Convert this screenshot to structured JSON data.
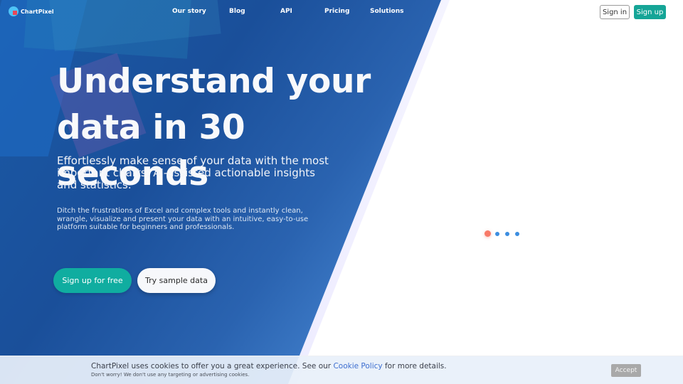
{
  "brand": {
    "name": "ChartPixel",
    "logo_icon": "chartpixel-logo-icon",
    "colors": {
      "primary_teal": "#15a597",
      "hero_blue_dark": "#1a4f9a",
      "hero_blue_light": "#68a8ee",
      "logo_circle": "#4fc3f7",
      "logo_square": "#e8485a",
      "loader_active": "#f87a68",
      "loader_idle": "#3d8ee0",
      "link": "#3e6fd0"
    }
  },
  "nav": {
    "items": [
      {
        "label": "Our story"
      },
      {
        "label": "Blog"
      },
      {
        "label": "API"
      },
      {
        "label": "Pricing"
      },
      {
        "label": "Solutions"
      }
    ],
    "sign_in_label": "Sign in",
    "sign_up_label": "Sign up"
  },
  "hero": {
    "title_line1": "Understand your",
    "title_line2": "data in 30 seconds",
    "subtitle": "Effortlessly make sense of your data with the most important charts, AI-assisted actionable insights and statistics.",
    "description": "Ditch the frustrations of Excel and complex tools and instantly clean, wrangle, visualize and present your data with an intuitive, easy-to-use platform suitable for beginners and professionals.",
    "cta_primary": "Sign up for free",
    "cta_secondary": "Try sample data"
  },
  "loader": {
    "dot_count": 4,
    "active_index": 0
  },
  "cookie_banner": {
    "text_before_link": "ChartPixel uses cookies to offer you a great experience. See our ",
    "link_text": "Cookie Policy",
    "text_after_link": " for more details.",
    "subtext": "Don't worry! We don't use any targeting or advertising cookies.",
    "accept_label": "Accept"
  }
}
